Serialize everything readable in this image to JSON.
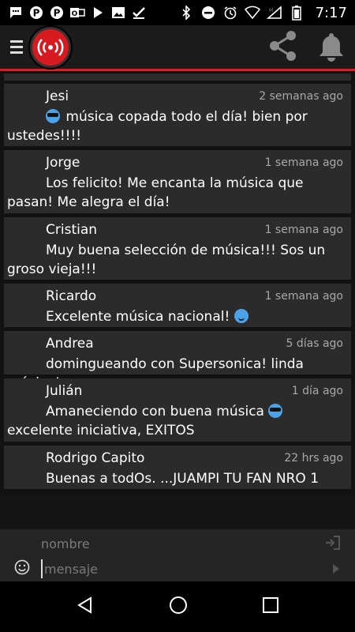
{
  "status_bar": {
    "time": "7:17",
    "left_icons": [
      "chat-icon",
      "pinterest-icon",
      "pinterest-icon",
      "outlook-icon",
      "play-icon",
      "image-icon",
      "check-icon"
    ],
    "right_icons": [
      "bluetooth-icon",
      "dnd-icon",
      "alarm-icon",
      "wifi-icon",
      "signal-icon",
      "battery-icon"
    ]
  },
  "app_bar": {
    "menu_icon": "hamburger-icon",
    "logo_icon": "radio-broadcast-icon",
    "share_icon": "share-icon",
    "notifications_icon": "bell-icon"
  },
  "comments": [
    {
      "name": "Jesi",
      "time": "2 semanas ago",
      "text": "música copada todo el día! bien por ustedes!!!!",
      "emoji": "cool",
      "emoji_pos": "start"
    },
    {
      "name": "Jorge",
      "time": "1 semana ago",
      "text": "Los felicito! Me encanta la música que pasan! Me alegra el día!"
    },
    {
      "name": "Cristian",
      "time": "1 semana ago",
      "text": "Muy buena selección de música!!! Sos un groso vieja!!!"
    },
    {
      "name": "Ricardo",
      "time": "1 semana ago",
      "text": "Excelente música nacional!",
      "emoji": "smile",
      "emoji_pos": "end"
    },
    {
      "name": "Andrea",
      "time": "5 días ago",
      "text": "domingueando con Supersonica! linda música!"
    },
    {
      "name": "Julián",
      "time": "1 día ago",
      "text_before": "Amaneciendo con buena música",
      "text_after": "excelente iniciativa, EXITOS",
      "emoji": "cool",
      "emoji_pos": "middle"
    },
    {
      "name": "Rodrigo Capito",
      "time": "22 hrs ago",
      "text": "Buenas a todOs. ...JUAMPI TU FAN NRO 1"
    }
  ],
  "composer": {
    "name_placeholder": "nombre",
    "message_placeholder": "mensaje"
  },
  "colors": {
    "accent": "#e21b23",
    "card": "#2b2b2b",
    "timestamp": "#a8a8a8"
  }
}
